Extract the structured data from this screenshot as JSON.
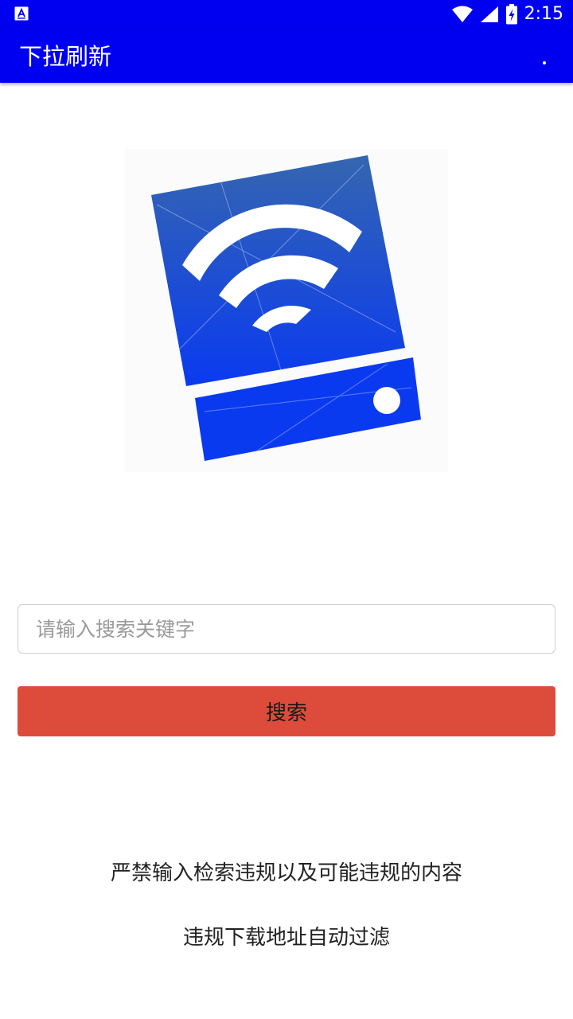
{
  "status_bar": {
    "time": "2:15",
    "icons": [
      "notification-a-icon",
      "wifi-icon",
      "cell-signal-icon",
      "battery-charging-icon"
    ]
  },
  "app_bar": {
    "title": "下拉刷新",
    "overflow_icon": "overflow-menu-icon"
  },
  "logo": {
    "icon": "wifi-hard-drive-logo",
    "colors": {
      "top": "#3566b0",
      "bottom": "#0a3af0",
      "background": "#fbfbfb"
    }
  },
  "search": {
    "placeholder": "请输入搜索关键字",
    "value": "",
    "button_label": "搜索",
    "button_color": "#dd4c3b"
  },
  "notices": {
    "line1": "严禁输入检索违规以及可能违规的内容",
    "line2": "违规下载地址自动过滤"
  },
  "theme": {
    "primary": "#0000f0"
  }
}
